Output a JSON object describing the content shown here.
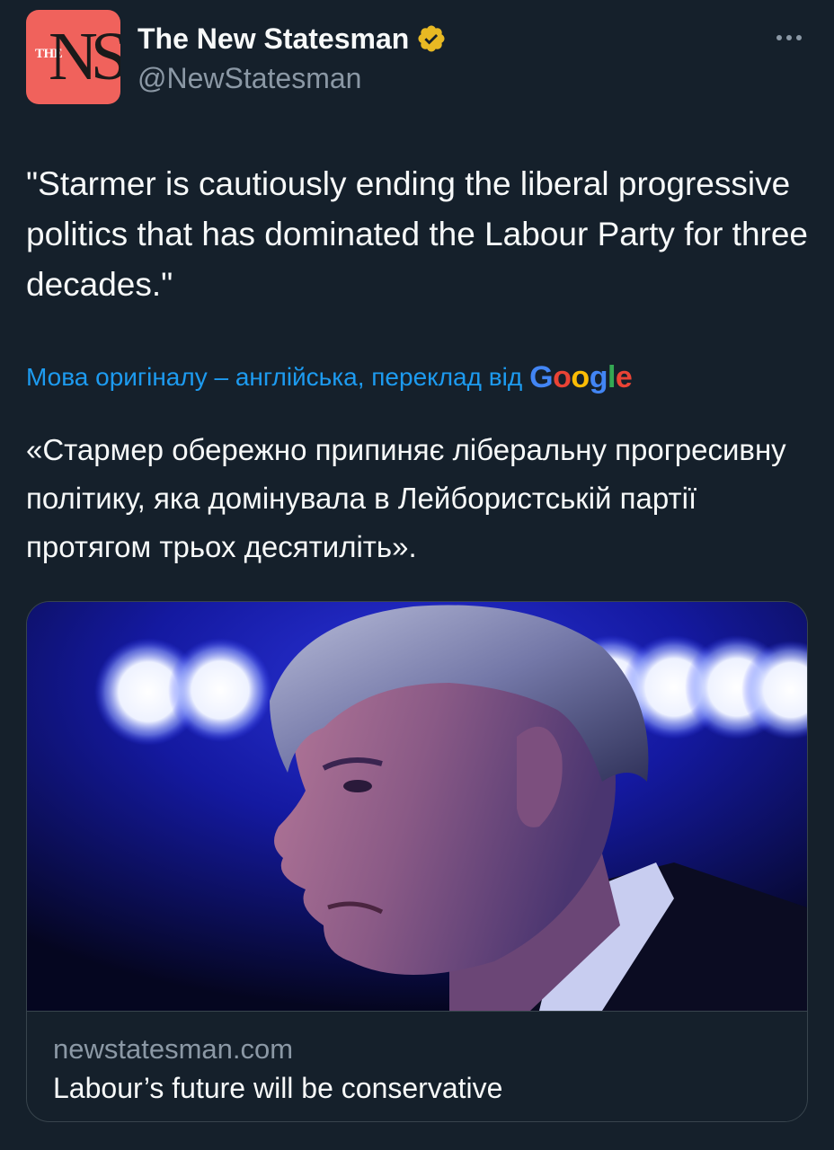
{
  "author": {
    "display_name": "The New Statesman",
    "handle": "@NewStatesman",
    "avatar_small_text": "THE",
    "avatar_large_text": "NS",
    "avatar_color": "#f0625c",
    "verified_badge_color": "#e8b923"
  },
  "tweet": {
    "text": "\"Starmer is cautiously ending the liberal progressive politics that has dominated the Labour Party for three decades.\"",
    "translation_note": "Мова оригіналу – англійська, переклад від",
    "translation_provider": "Google",
    "translated_text": "«Стармер обережно припиняє ліберальну прогресивну політику, яка домінувала в Лейбористській партії протягом трьох десятиліть»."
  },
  "link_card": {
    "domain": "newstatesman.com",
    "title": "Labour’s future will be conservative"
  },
  "colors": {
    "background": "#15202b",
    "accent": "#1d9bf0",
    "secondary_text": "#8b98a5"
  }
}
